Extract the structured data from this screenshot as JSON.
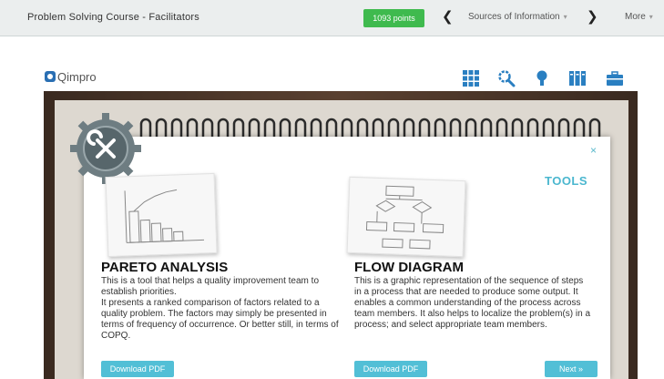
{
  "topbar": {
    "course_title": "Problem Solving Course - Facilitators",
    "points": "1093 points",
    "nav_label": "Sources of Information",
    "more_label": "More"
  },
  "brand": {
    "logo_text": "Qimpro"
  },
  "panel": {
    "section_label": "TOOLS",
    "close_symbol": "×",
    "tools": [
      {
        "title": "PARETO ANALYSIS",
        "description_1": "This is a tool that helps a quality improvement team to establish priorities.",
        "description_2": "It presents a ranked comparison of factors related to a quality problem. The factors may simply be presented in terms of frequency of occurrence. Or better still, in terms of COPQ.",
        "button_label": "Download PDF"
      },
      {
        "title": "FLOW DIAGRAM",
        "description_1": "This is a graphic representation of the sequence of steps in a process that are needed to produce some output. It enables a common understanding of the process across team members. It also helps to localize the problem(s) in a process; and select appropriate team members.",
        "button_label": "Download PDF"
      }
    ],
    "next_label": "Next »"
  },
  "colors": {
    "accent": "#52bfd6",
    "points_green": "#3fba4e",
    "icon_blue": "#2a6fb3"
  }
}
